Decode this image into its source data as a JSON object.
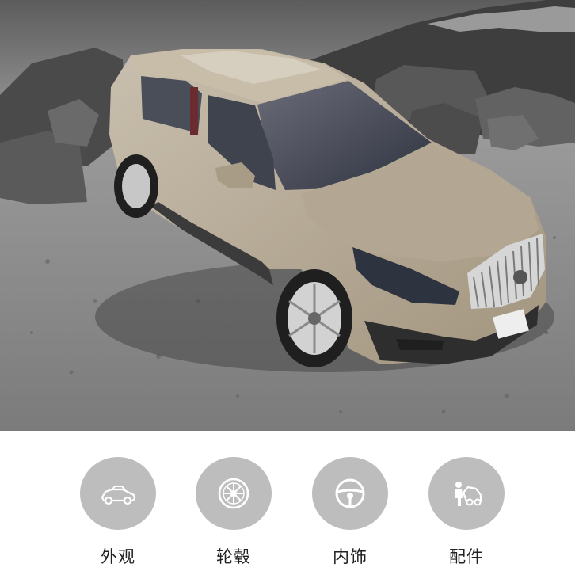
{
  "hero": {
    "image": "car-3d-view",
    "scene": "suv-on-rocky-mountain-terrain"
  },
  "nav": {
    "items": [
      {
        "label": "外观",
        "icon": "car-exterior-icon"
      },
      {
        "label": "轮毂",
        "icon": "wheel-rim-icon"
      },
      {
        "label": "内饰",
        "icon": "steering-wheel-icon"
      },
      {
        "label": "配件",
        "icon": "accessory-icon"
      }
    ]
  },
  "colors": {
    "icon_circle": "#bdbdbd",
    "icon_glyph": "#ffffff",
    "label_text": "#222222",
    "car_body": "#b7ab97"
  }
}
